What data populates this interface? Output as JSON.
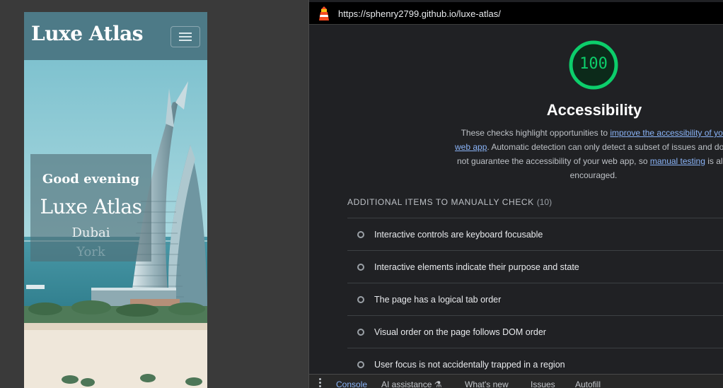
{
  "preview": {
    "brand": "Luxe Atlas",
    "menu_icon": "hamburger-menu-icon",
    "hero": {
      "greeting": "Good evening",
      "title": "Luxe Atlas",
      "cities": [
        "Dubai",
        "York"
      ]
    }
  },
  "devtools": {
    "url": "https://sphenry2799.github.io/luxe-atlas/",
    "lighthouse_icon": "lighthouse-icon",
    "score": "100",
    "score_color": "#0cce6b",
    "category_title": "Accessibility",
    "description": {
      "line1_pre": "These checks highlight opportunities to ",
      "link1_part1": "improve the accessibility of your",
      "link1_part2": "web app",
      "line2_post": ". Automatic detection can only detect a subset of issues and does",
      "line3_pre": "not guarantee the accessibility of your web app, so ",
      "link2": "manual testing",
      "line3_post": " is also",
      "line4": "encouraged."
    },
    "manual_section": {
      "title": "ADDITIONAL ITEMS TO MANUALLY CHECK",
      "count": "(10)",
      "items": [
        "Interactive controls are keyboard focusable",
        "Interactive elements indicate their purpose and state",
        "The page has a logical tab order",
        "Visual order on the page follows DOM order",
        "User focus is not accidentally trapped in a region"
      ]
    },
    "drawer_tabs": {
      "console": "Console",
      "ai": "AI assistance",
      "ai_icon": "flask-icon",
      "whats_new": "What's new",
      "issues": "Issues",
      "autofill": "Autofill"
    }
  }
}
